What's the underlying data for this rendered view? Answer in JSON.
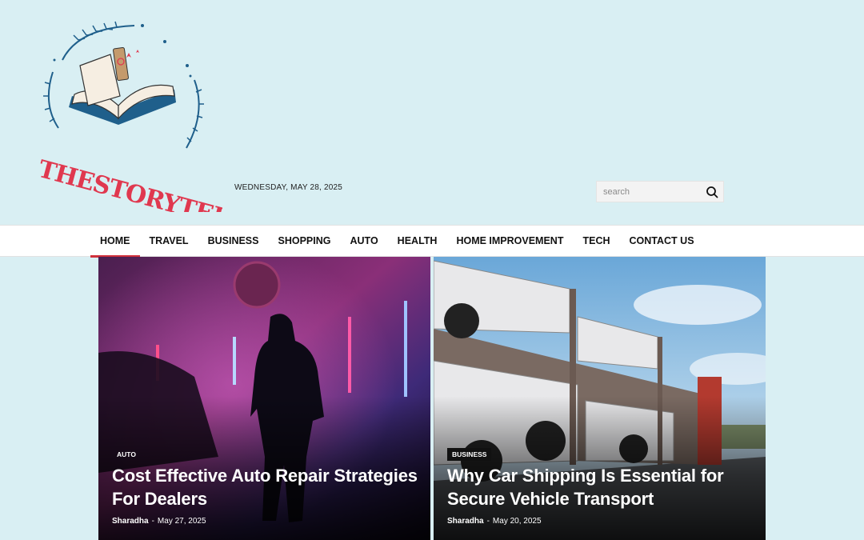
{
  "header": {
    "logo_text": "THESTORYTELERS",
    "date": "WEDNESDAY, MAY 28, 2025",
    "search": {
      "placeholder": "search"
    }
  },
  "nav": {
    "items": [
      {
        "label": "HOME"
      },
      {
        "label": "TRAVEL"
      },
      {
        "label": "BUSINESS"
      },
      {
        "label": "SHOPPING"
      },
      {
        "label": "AUTO"
      },
      {
        "label": "HEALTH"
      },
      {
        "label": "HOME IMPROVEMENT"
      },
      {
        "label": "TECH"
      },
      {
        "label": "CONTACT US"
      }
    ]
  },
  "featured": [
    {
      "category": "AUTO",
      "title": "Cost Effective Auto Repair Strategies For Dealers",
      "author": "Sharadha",
      "separator": "-",
      "date": "May 27, 2025"
    },
    {
      "category": "BUSINESS",
      "title": "Why Car Shipping Is Essential for Secure Vehicle Transport",
      "author": "Sharadha",
      "separator": "-",
      "date": "May 20, 2025"
    }
  ],
  "colors": {
    "page_bg": "#d9eff3",
    "accent_red": "#d1313c",
    "logo_blue": "#1f5f8b",
    "logo_pink": "#e0384f"
  },
  "icons": {
    "search": "search-icon",
    "logo": "open-book-icon"
  }
}
